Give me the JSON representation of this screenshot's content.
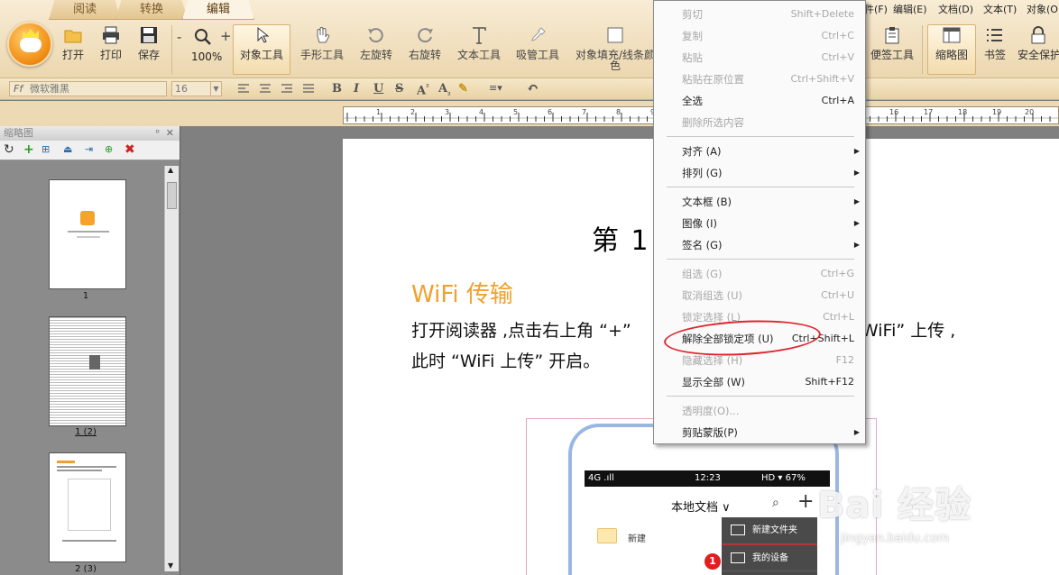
{
  "tabs": [
    {
      "label": "阅读"
    },
    {
      "label": "转换"
    },
    {
      "label": "编辑"
    }
  ],
  "menubar_right": [
    "件(F)",
    "编辑(E)",
    "文档(D)",
    "文本(T)",
    "对象(O"
  ],
  "toolbar": {
    "open": "打开",
    "print": "打印",
    "save": "保存",
    "zoom": "100%",
    "zoom_minus": "-",
    "zoom_plus": "+",
    "object_tool": "对象工具",
    "hand_tool": "手形工具",
    "rotate_left": "左旋转",
    "rotate_right": "右旋转",
    "text_tool": "文本工具",
    "eyedropper": "吸管工具",
    "object_fill": "对象填充/线条颜色",
    "sticky_tool": "便签工具",
    "thumbnail": "缩略图",
    "bookmark": "书签",
    "security": "安全保护"
  },
  "format": {
    "font": "微软雅黑",
    "font_prefix": "Ff",
    "size": "16"
  },
  "ruler_numbers": [
    "1",
    "2",
    "3",
    "4",
    "5",
    "6",
    "7",
    "8",
    "9",
    "10",
    "16",
    "17",
    "18",
    "19",
    "20"
  ],
  "panel": {
    "title": "缩略图",
    "thumbs": [
      {
        "label": "1"
      },
      {
        "label": "1 (2)"
      },
      {
        "label": "2 (3)"
      }
    ]
  },
  "document": {
    "heading": "第 1 章",
    "wifi_title": "WiFi 传输",
    "para_line1_a": "打开阅读器 ,点击右上角 “+”",
    "para_line1_b": "击 “WiFi” 上传 ,",
    "para_line2": "此时 “WiFi 上传” 开启。"
  },
  "phone": {
    "signal": "4G .ıll",
    "time": "12:23",
    "status_right": "HD ▾ 67%",
    "title": "本地文档 ∨",
    "new_folder_item": "新建",
    "menu_new_folder": "新建文件夹",
    "menu_my_device": "我的设备",
    "badge": "1"
  },
  "context_menu": {
    "items": [
      {
        "label": "剪切",
        "shortcut": "Shift+Delete",
        "disabled": true
      },
      {
        "label": "复制",
        "shortcut": "Ctrl+C",
        "disabled": true
      },
      {
        "label": "粘贴",
        "shortcut": "Ctrl+V",
        "disabled": true
      },
      {
        "label": "粘贴在原位置",
        "shortcut": "Ctrl+Shift+V",
        "disabled": true
      },
      {
        "label": "全选",
        "shortcut": "Ctrl+A",
        "disabled": false
      },
      {
        "label": "删除所选内容",
        "shortcut": "",
        "disabled": true
      },
      {
        "label": "对齐 (A)",
        "shortcut": "",
        "disabled": false,
        "submenu": true
      },
      {
        "label": "排列 (G)",
        "shortcut": "",
        "disabled": false,
        "submenu": true
      },
      {
        "label": "文本框 (B)",
        "shortcut": "",
        "disabled": false,
        "submenu": true
      },
      {
        "label": "图像 (I)",
        "shortcut": "",
        "disabled": false,
        "submenu": true
      },
      {
        "label": "签名 (G)",
        "shortcut": "",
        "disabled": false,
        "submenu": true
      },
      {
        "label": "组选 (G)",
        "shortcut": "Ctrl+G",
        "disabled": true
      },
      {
        "label": "取消组选 (U)",
        "shortcut": "Ctrl+U",
        "disabled": true
      },
      {
        "label": "锁定选择 (L)",
        "shortcut": "Ctrl+L",
        "disabled": true
      },
      {
        "label": "解除全部锁定项 (U)",
        "shortcut": "Ctrl+Shift+L",
        "disabled": false
      },
      {
        "label": "隐藏选择 (H)",
        "shortcut": "F12",
        "disabled": true
      },
      {
        "label": "显示全部 (W)",
        "shortcut": "Shift+F12",
        "disabled": false
      },
      {
        "label": "透明度(O)...",
        "shortcut": "",
        "disabled": true
      },
      {
        "label": "剪贴蒙版(P)",
        "shortcut": "",
        "disabled": false,
        "submenu": true
      }
    ],
    "submenu_arrow": "▶"
  },
  "watermark": {
    "main": "Bai  经验",
    "sub": "jingyan.baidu.com"
  },
  "colors": {
    "accent_orange": "#f0a02e",
    "highlight_red": "#e0262f",
    "ribbon_bg": "#ecd7af"
  }
}
